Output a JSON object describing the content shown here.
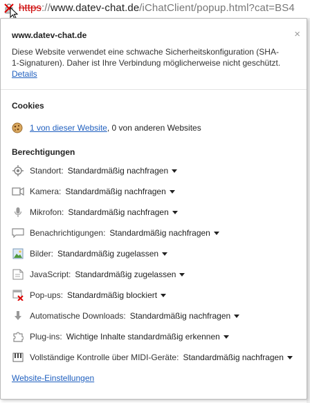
{
  "address_bar": {
    "scheme": "https",
    "scheme_sep": "://",
    "host": "www.datev-chat.de",
    "path": "/iChatClient/popup.html?cat=BS4"
  },
  "popup": {
    "site": "www.datev-chat.de",
    "warning": "Diese Website verwendet eine schwache Sicherheitskonfiguration (SHA-1-Signaturen). Daher ist Ihre Verbindung möglicherweise nicht geschützt.",
    "details_link": "Details",
    "close_glyph": "×",
    "cookies": {
      "title": "Cookies",
      "link": "1 von dieser Website",
      "rest": ", 0 von anderen Websites"
    },
    "permissions_title": "Berechtigungen",
    "permissions": [
      {
        "label": "Standort:",
        "value": "Standardmäßig nachfragen"
      },
      {
        "label": "Kamera:",
        "value": "Standardmäßig nachfragen"
      },
      {
        "label": "Mikrofon:",
        "value": "Standardmäßig nachfragen"
      },
      {
        "label": "Benachrichtigungen:",
        "value": "Standardmäßig nachfragen"
      },
      {
        "label": "Bilder:",
        "value": "Standardmäßig zugelassen"
      },
      {
        "label": "JavaScript:",
        "value": "Standardmäßig zugelassen"
      },
      {
        "label": "Pop-ups:",
        "value": "Standardmäßig blockiert"
      },
      {
        "label": "Automatische Downloads:",
        "value": "Standardmäßig nachfragen"
      },
      {
        "label": "Plug-ins:",
        "value": "Wichtige Inhalte standardmäßig erkennen"
      },
      {
        "label": "Vollständige Kontrolle über MIDI-Geräte:",
        "value": "Standardmäßig nachfragen"
      }
    ],
    "settings_link": "Website-Einstellungen"
  },
  "icons": {
    "lock": "broken-lock-icon",
    "cookie": "cookie-icon",
    "location": "location-icon",
    "camera": "camera-icon",
    "microphone": "microphone-icon",
    "notifications": "notification-icon",
    "images": "image-icon",
    "javascript": "javascript-icon",
    "popups": "popup-blocked-icon",
    "downloads": "download-icon",
    "plugins": "plugin-icon",
    "midi": "midi-icon"
  },
  "colors": {
    "link": "#1f5fbf",
    "insecure": "#cc0000"
  }
}
